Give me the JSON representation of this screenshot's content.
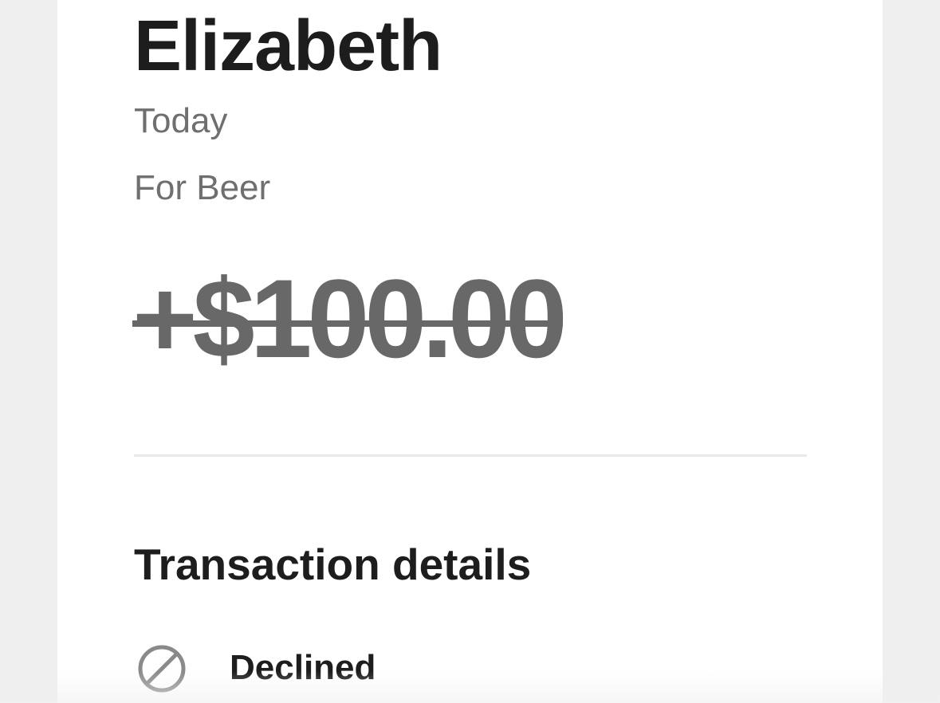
{
  "transaction": {
    "counterparty": "Elizabeth",
    "date": "Today",
    "note": "For Beer",
    "amount": "+$100.00",
    "amount_struck_through": true
  },
  "details": {
    "title": "Transaction details",
    "status": {
      "icon": "prohibited-icon",
      "label": "Declined"
    }
  },
  "colors": {
    "primary_text": "#1d1d1d",
    "secondary_text": "#6f6f6f",
    "amount_text": "#686868",
    "page_background": "#efefef",
    "card_background": "#ffffff"
  }
}
